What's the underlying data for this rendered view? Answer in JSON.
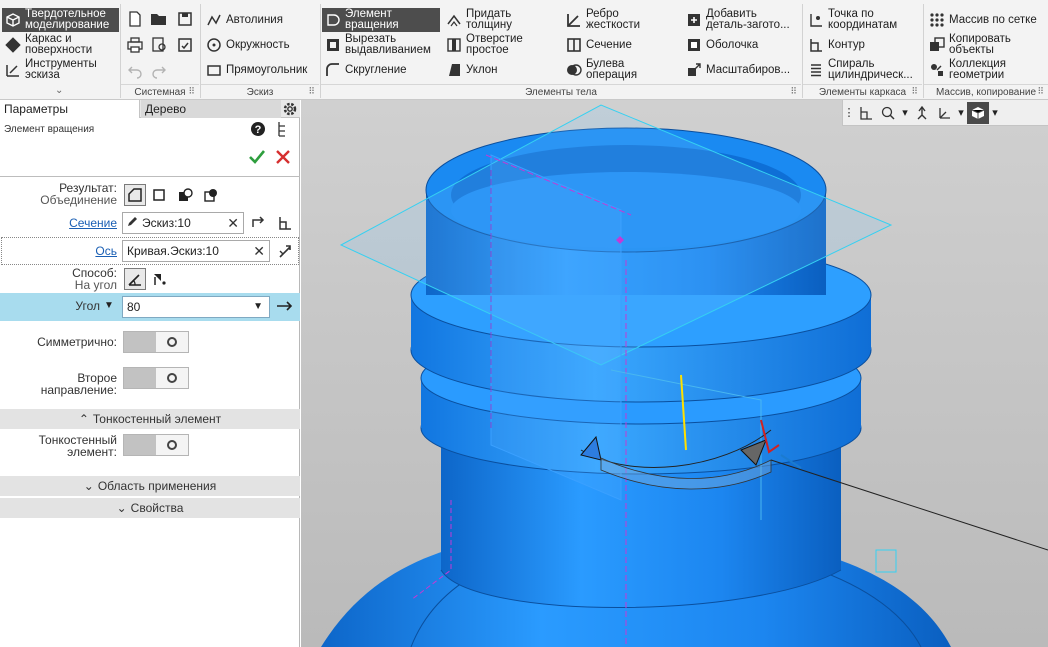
{
  "colors": {
    "ribbon_bg": "#f3f3f3",
    "active_bg": "#4d4d4d",
    "accent_blue": "#2f8fe8",
    "model_blue": "#1e8ef5",
    "angle_row_bg": "#a8dcee",
    "link": "#1a5fb4",
    "ok_green": "#2e9e3e",
    "cancel_red": "#d62f2f"
  },
  "ribbon": {
    "modes": [
      {
        "label": "Твердотельное\nмоделирование",
        "icon": "solid-cube-icon",
        "active": true
      },
      {
        "label": "Каркас и\nповерхности",
        "icon": "wireframe-icon",
        "active": false
      },
      {
        "label": "Инструменты\nэскиза",
        "icon": "sketch-tools-icon",
        "active": false
      }
    ],
    "groups": {
      "system": "Системная",
      "sketch": "Эскиз",
      "body": "Элементы тела",
      "frame": "Элементы каркаса",
      "array": "Массив, копирование"
    },
    "sketch_items": [
      "Автолиния",
      "Окружность",
      "Прямоугольник"
    ],
    "body_col1": [
      "Элемент\nвращения",
      "Вырезать\nвыдавливанием",
      "Скругление"
    ],
    "body_col2": [
      "Придать\nтолщину",
      "Отверстие\nпростое",
      "Уклон"
    ],
    "body_col3": [
      "Ребро\nжесткости",
      "Сечение",
      "Булева\nоперация"
    ],
    "body_col4": [
      "Добавить\nдеталь-загото...",
      "Оболочка",
      "Масштабиров..."
    ],
    "frame_items": [
      "Точка по\nкоординатам",
      "Контур",
      "Спираль\nцилиндрическ..."
    ],
    "array_items": [
      "Массив по сетке",
      "Копировать\nобъекты",
      "Коллекция\nгеометрии"
    ]
  },
  "panel": {
    "tab_params": "Параметры",
    "tab_tree": "Дерево",
    "operation_title": "Элемент вращения",
    "result_label": "Результат:",
    "result_value": "Объединение",
    "section_label": "Сечение",
    "section_value": "Эскиз:10",
    "axis_label": "Ось",
    "axis_value": "Кривая.Эскиз:10",
    "method_label": "Способ:",
    "method_value": "На угол",
    "angle_label": "Угол",
    "angle_value": "80",
    "symmetric_label": "Симметрично:",
    "second_dir_label": "Второе направление:",
    "thin_section": "Тонкостенный элемент",
    "thin_label": "Тонкостенный\nэлемент:",
    "scope_section": "Область применения",
    "props_section": "Свойства"
  }
}
